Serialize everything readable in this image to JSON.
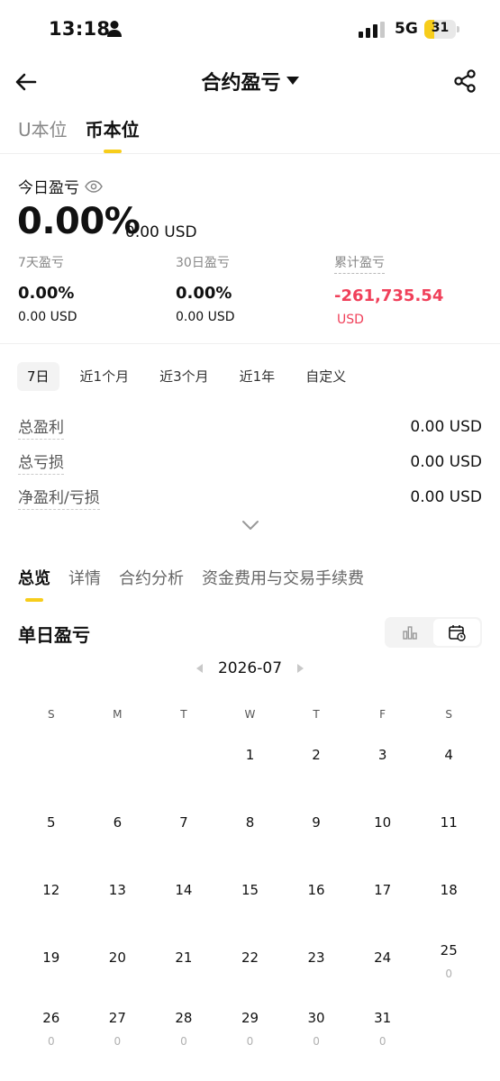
{
  "status_bar": {
    "time": "13:18",
    "network": "5G",
    "battery": "31",
    "battery_level": 0.31
  },
  "header": {
    "title": "合约盈亏"
  },
  "unit_tabs": [
    {
      "label": "U本位",
      "active": false
    },
    {
      "label": "币本位",
      "active": true
    }
  ],
  "today": {
    "label": "今日盈亏",
    "percent": "0.00%",
    "usd": "0.00 USD"
  },
  "stats": [
    {
      "label": "7天盈亏",
      "value": "0.00%",
      "sub": "0.00 USD"
    },
    {
      "label": "30日盈亏",
      "value": "0.00%",
      "sub": "0.00 USD"
    },
    {
      "label": "累计盈亏",
      "value": "-261,735.54",
      "sub": "USD"
    }
  ],
  "periods": [
    {
      "label": "7日",
      "active": true
    },
    {
      "label": "近1个月",
      "active": false
    },
    {
      "label": "近3个月",
      "active": false
    },
    {
      "label": "近1年",
      "active": false
    },
    {
      "label": "自定义",
      "active": false
    }
  ],
  "summary": [
    {
      "label": "总盈利",
      "value": "0.00 USD"
    },
    {
      "label": "总亏损",
      "value": "0.00 USD"
    },
    {
      "label": "净盈利/亏损",
      "value": "0.00 USD"
    }
  ],
  "content_tabs": [
    {
      "label": "总览",
      "active": true
    },
    {
      "label": "详情",
      "active": false
    },
    {
      "label": "合约分析",
      "active": false
    },
    {
      "label": "资金费用与交易手续费",
      "active": false
    }
  ],
  "daily": {
    "title": "单日盈亏",
    "month": "2026-07"
  },
  "calendar": {
    "weekdays": [
      "S",
      "M",
      "T",
      "W",
      "T",
      "F",
      "S"
    ],
    "first_weekday": 3,
    "days": [
      {
        "day": "1"
      },
      {
        "day": "2"
      },
      {
        "day": "3"
      },
      {
        "day": "4"
      },
      {
        "day": "5"
      },
      {
        "day": "6"
      },
      {
        "day": "7"
      },
      {
        "day": "8"
      },
      {
        "day": "9"
      },
      {
        "day": "10"
      },
      {
        "day": "11"
      },
      {
        "day": "12"
      },
      {
        "day": "13"
      },
      {
        "day": "14"
      },
      {
        "day": "15"
      },
      {
        "day": "16"
      },
      {
        "day": "17"
      },
      {
        "day": "18"
      },
      {
        "day": "19"
      },
      {
        "day": "20"
      },
      {
        "day": "21"
      },
      {
        "day": "22"
      },
      {
        "day": "23"
      },
      {
        "day": "24"
      },
      {
        "day": "25",
        "pnl": "0"
      },
      {
        "day": "26",
        "pnl": "0"
      },
      {
        "day": "27",
        "pnl": "0"
      },
      {
        "day": "28",
        "pnl": "0"
      },
      {
        "day": "29",
        "pnl": "0"
      },
      {
        "day": "30",
        "pnl": "0"
      },
      {
        "day": "31",
        "pnl": "0"
      }
    ]
  },
  "colors": {
    "accent": "#f7cd1b",
    "loss": "#f0405a"
  }
}
